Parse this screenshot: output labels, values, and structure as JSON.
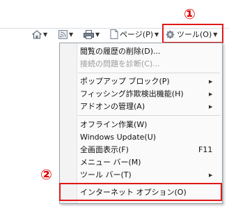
{
  "callouts": {
    "first": "①",
    "second": "②"
  },
  "toolbar": {
    "page_label": "ページ(P)",
    "tools_label": "ツール(O)"
  },
  "menu": {
    "items": [
      {
        "label": "閲覧の履歴の削除(D)...",
        "enabled": true
      },
      {
        "label": "接続の問題を診断(C)...",
        "enabled": false
      },
      {
        "label": "ポップアップ ブロック(P)",
        "enabled": true,
        "submenu": true
      },
      {
        "label": "フィッシング詐欺検出機能(H)",
        "enabled": true,
        "submenu": true
      },
      {
        "label": "アドオンの管理(A)",
        "enabled": true,
        "submenu": true
      },
      {
        "label": "オフライン作業(W)",
        "enabled": true
      },
      {
        "label": "Windows Update(U)",
        "enabled": true
      },
      {
        "label": "全画面表示(F)",
        "enabled": true,
        "accelerator": "F11"
      },
      {
        "label": "メニュー バー(M)",
        "enabled": true
      },
      {
        "label": "ツール バー(T)",
        "enabled": true,
        "submenu": true
      },
      {
        "label": "インターネット オプション(O)",
        "enabled": true,
        "highlighted": true
      }
    ]
  },
  "colors": {
    "callout": "#e00000",
    "menu_border": "#9aa3ad"
  }
}
